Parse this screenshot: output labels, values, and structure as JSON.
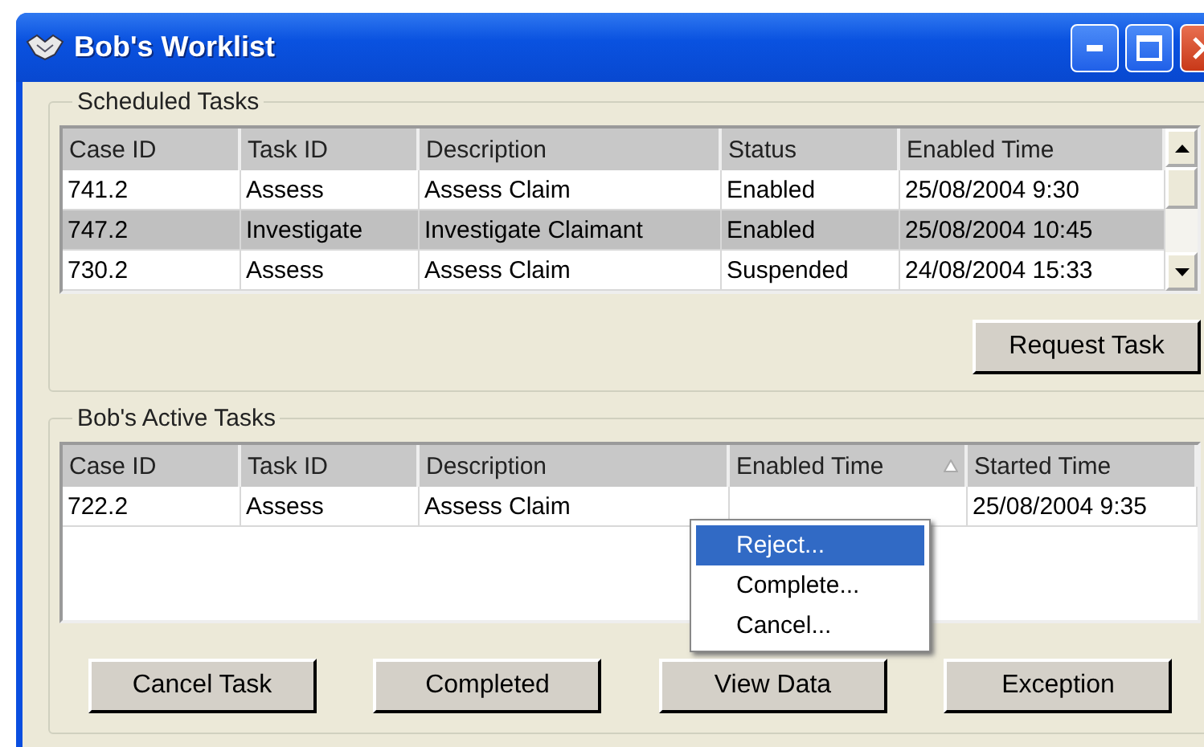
{
  "window": {
    "title": "Bob's Worklist"
  },
  "scheduled_tasks": {
    "title": "Scheduled Tasks",
    "table": {
      "columns": [
        {
          "label": "Case ID",
          "sorted": false
        },
        {
          "label": "Task ID",
          "sorted": false
        },
        {
          "label": "Description",
          "sorted": false
        },
        {
          "label": "Status",
          "sorted": false
        },
        {
          "label": "Enabled Time",
          "sorted": false
        }
      ],
      "rows": [
        {
          "cells": [
            "741.2",
            "Assess",
            "Assess Claim",
            "Enabled",
            "25/08/2004 9:30"
          ],
          "selected": false
        },
        {
          "cells": [
            "747.2",
            "Investigate",
            "Investigate Claimant",
            "Enabled",
            "25/08/2004 10:45"
          ],
          "selected": true
        },
        {
          "cells": [
            "730.2",
            "Assess",
            "Assess Claim",
            "Suspended",
            "24/08/2004 15:33"
          ],
          "selected": false
        }
      ]
    },
    "buttons": [
      "Request Task"
    ]
  },
  "active_tasks": {
    "title": "Bob's Active Tasks",
    "table": {
      "columns": [
        {
          "label": "Case ID",
          "sorted": false
        },
        {
          "label": "Task ID",
          "sorted": false
        },
        {
          "label": "Description",
          "sorted": false
        },
        {
          "label": "Enabled Time",
          "sorted": true
        },
        {
          "label": "Started Time",
          "sorted": false
        }
      ],
      "rows": [
        {
          "cells": [
            "722.2",
            "Assess",
            "Assess Claim",
            null,
            "25/08/2004 9:35"
          ],
          "selected": false
        }
      ]
    },
    "buttons": [
      "Cancel Task",
      "Completed",
      "View Data",
      "Exception"
    ]
  },
  "context_menu": {
    "items": [
      {
        "label": "Reject...",
        "selected": true
      },
      {
        "label": "Complete...",
        "selected": false
      },
      {
        "label": "Cancel...",
        "selected": false
      }
    ]
  }
}
